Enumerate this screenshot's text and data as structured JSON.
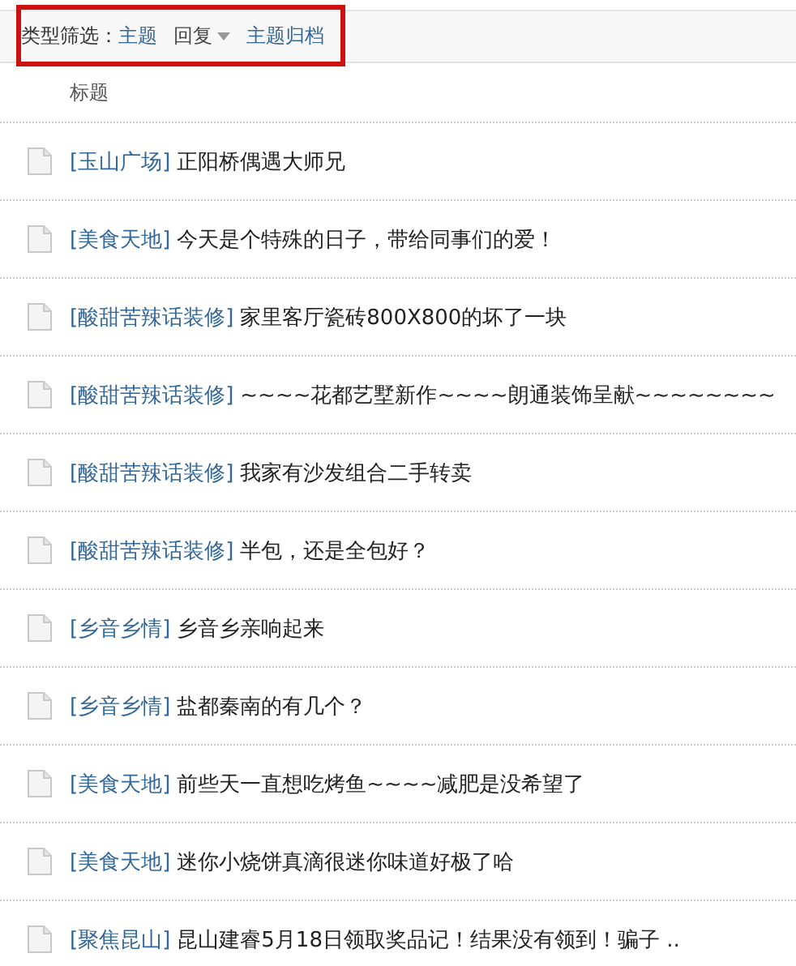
{
  "filter_bar": {
    "label": "类型筛选：",
    "options": [
      {
        "kind": "link",
        "label": "主题"
      },
      {
        "kind": "dropdown",
        "label": "回复"
      },
      {
        "kind": "link",
        "label": "主题归档"
      }
    ]
  },
  "table": {
    "columns": [
      "标题"
    ],
    "rows": [
      {
        "category": "[玉山广场]",
        "title": "正阳桥偶遇大师兄"
      },
      {
        "category": "[美食天地]",
        "title": "今天是个特殊的日子，带给同事们的爱！"
      },
      {
        "category": "[酸甜苦辣话装修]",
        "title": "家里客厅瓷砖800X800的坏了一块"
      },
      {
        "category": "[酸甜苦辣话装修]",
        "title": "~~~~花都艺墅新作~~~~朗通装饰呈献~~~~~~~~"
      },
      {
        "category": "[酸甜苦辣话装修]",
        "title": "我家有沙发组合二手转卖"
      },
      {
        "category": "[酸甜苦辣话装修]",
        "title": "半包，还是全包好？"
      },
      {
        "category": "[乡音乡情]",
        "title": "乡音乡亲响起来"
      },
      {
        "category": "[乡音乡情]",
        "title": "盐都秦南的有几个？"
      },
      {
        "category": "[美食天地]",
        "title": "前些天一直想吃烤鱼~~~~减肥是没希望了"
      },
      {
        "category": "[美食天地]",
        "title": "迷你小烧饼真滴很迷你味道好极了哈"
      },
      {
        "category": "[聚焦昆山]",
        "title": "昆山建睿5月18日领取奖品记！结果没有领到！骗子 .."
      }
    ]
  }
}
